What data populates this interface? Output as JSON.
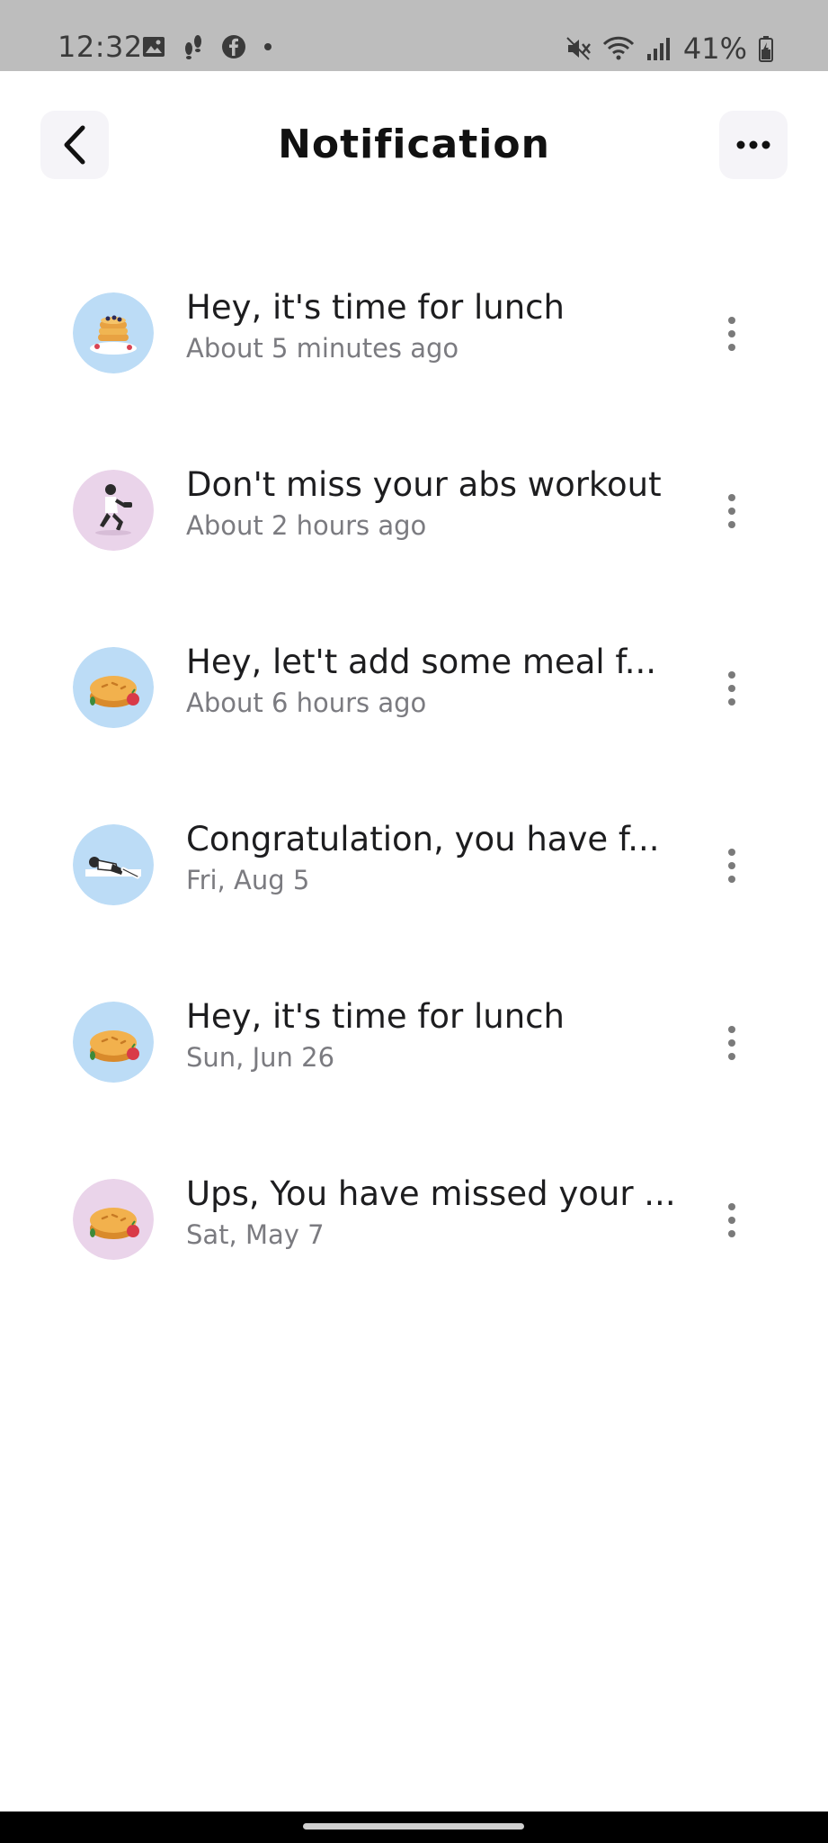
{
  "status_bar": {
    "time": "12:32",
    "battery_percent": "41%",
    "left_icons": [
      "gallery-icon",
      "steps-icon",
      "facebook-icon",
      "dot-icon"
    ],
    "right_icons": [
      "mute-icon",
      "wifi-icon",
      "signal-icon",
      "battery-icon"
    ]
  },
  "header": {
    "title": "Notification",
    "back_icon": "chevron-left-icon",
    "more_icon": "more-horizontal-icon"
  },
  "notifications": [
    {
      "title": "Hey, it's time for lunch",
      "time": "About 5 minutes ago",
      "avatar_bg": "#bcdcf6",
      "avatar_icon": "pancakes-icon"
    },
    {
      "title": "Don't miss your abs workout",
      "time": "About 2 hours ago",
      "avatar_bg": "#ead4ea",
      "avatar_icon": "workout-icon"
    },
    {
      "title": "Hey, let't add some meal f...",
      "time": "About 6 hours ago",
      "avatar_bg": "#bcdcf6",
      "avatar_icon": "pie-icon"
    },
    {
      "title": "Congratulation, you have f...",
      "time": "Fri, Aug 5",
      "avatar_bg": "#bcdcf6",
      "avatar_icon": "sleeping-icon"
    },
    {
      "title": "Hey, it's time for lunch",
      "time": "Sun, Jun 26",
      "avatar_bg": "#bcdcf6",
      "avatar_icon": "pie-icon"
    },
    {
      "title": "Ups, You have missed your ...",
      "time": "Sat, May 7",
      "avatar_bg": "#ead4ea",
      "avatar_icon": "pie-icon"
    }
  ]
}
